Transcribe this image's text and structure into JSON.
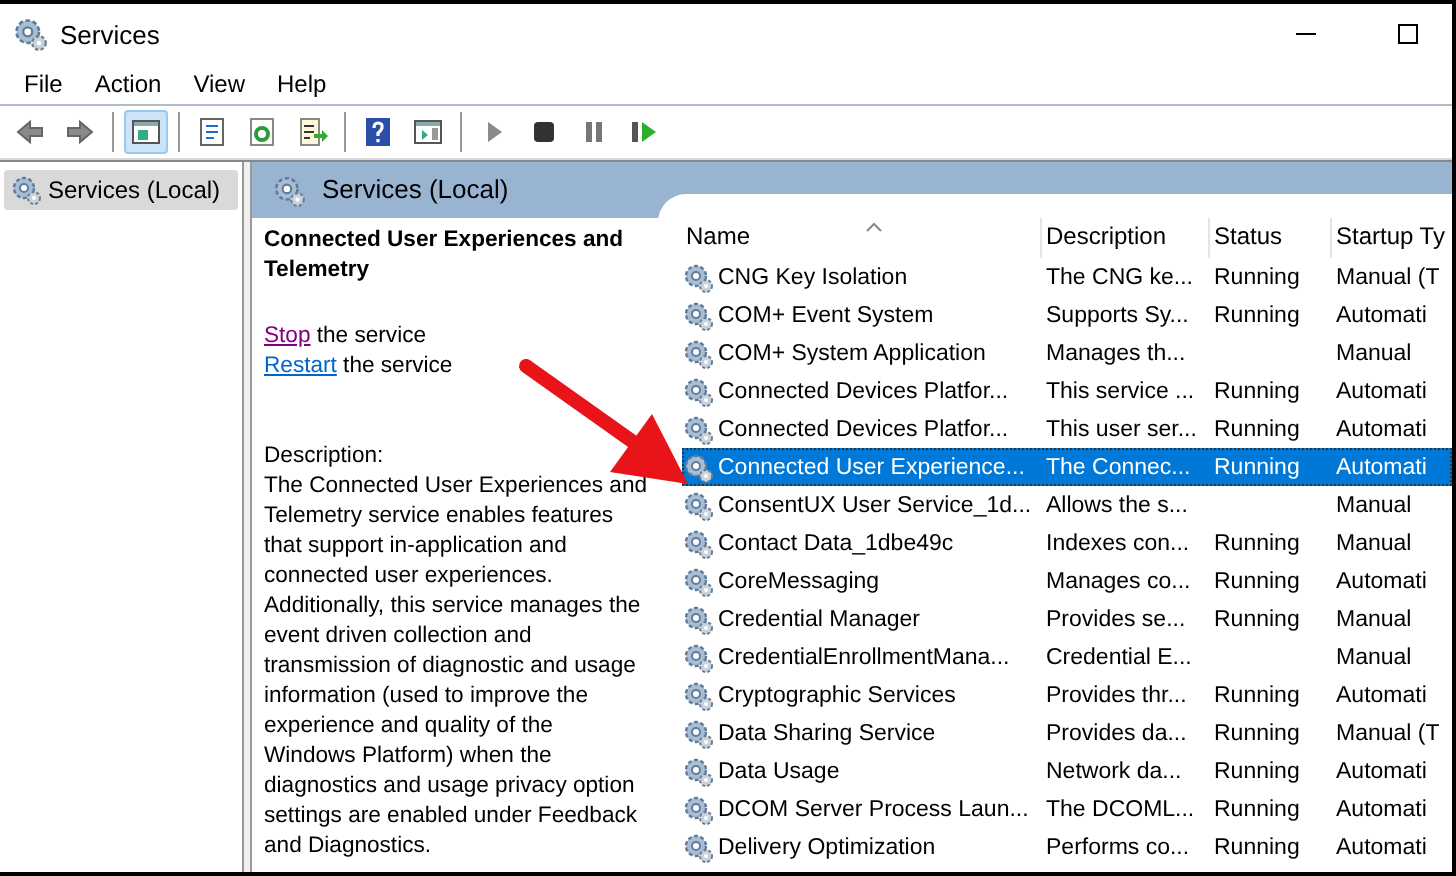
{
  "window": {
    "title": "Services"
  },
  "menu": [
    "File",
    "Action",
    "View",
    "Help"
  ],
  "toolbar": [
    {
      "kind": "back",
      "selected": false
    },
    {
      "kind": "forward",
      "selected": false
    },
    {
      "kind": "sep"
    },
    {
      "kind": "tree",
      "selected": true
    },
    {
      "kind": "sep"
    },
    {
      "kind": "properties",
      "selected": false
    },
    {
      "kind": "refresh",
      "selected": false
    },
    {
      "kind": "export",
      "selected": false
    },
    {
      "kind": "sep"
    },
    {
      "kind": "help",
      "selected": false
    },
    {
      "kind": "pane",
      "selected": false
    },
    {
      "kind": "sep"
    },
    {
      "kind": "play",
      "selected": false
    },
    {
      "kind": "stop",
      "selected": false
    },
    {
      "kind": "pause",
      "selected": false
    },
    {
      "kind": "restart",
      "selected": false
    }
  ],
  "tree": {
    "items": [
      {
        "label": "Services (Local)",
        "selected": true
      }
    ]
  },
  "panel": {
    "title": "Services (Local)"
  },
  "details": {
    "title": "Connected User Experiences and Telemetry",
    "actions": [
      {
        "link": "Stop",
        "text": "the service",
        "visited": true
      },
      {
        "link": "Restart",
        "text": "the service",
        "visited": false
      }
    ],
    "description_label": "Description:",
    "description": "The Connected User Experiences and Telemetry service enables features that support in-application and connected user experiences. Additionally, this service manages the event driven collection and transmission of diagnostic and usage information (used to improve the experience and quality of the Windows Platform) when the diagnostics and usage privacy option settings are enabled under Feedback and Diagnostics."
  },
  "table": {
    "columns": [
      "Name",
      "Description",
      "Status",
      "Startup Ty"
    ],
    "rows": [
      {
        "cells": [
          "CNG Key Isolation",
          "The CNG ke...",
          "Running",
          "Manual (T"
        ],
        "selected": false
      },
      {
        "cells": [
          "COM+ Event System",
          "Supports Sy...",
          "Running",
          "Automati"
        ],
        "selected": false
      },
      {
        "cells": [
          "COM+ System Application",
          "Manages th...",
          "",
          "Manual"
        ],
        "selected": false
      },
      {
        "cells": [
          "Connected Devices Platfor...",
          "This service ...",
          "Running",
          "Automati"
        ],
        "selected": false
      },
      {
        "cells": [
          "Connected Devices Platfor...",
          "This user ser...",
          "Running",
          "Automati"
        ],
        "selected": false
      },
      {
        "cells": [
          "Connected User Experience...",
          "The Connec...",
          "Running",
          "Automati"
        ],
        "selected": true
      },
      {
        "cells": [
          "ConsentUX User Service_1d...",
          "Allows the s...",
          "",
          "Manual"
        ],
        "selected": false
      },
      {
        "cells": [
          "Contact Data_1dbe49c",
          "Indexes con...",
          "Running",
          "Manual"
        ],
        "selected": false
      },
      {
        "cells": [
          "CoreMessaging",
          "Manages co...",
          "Running",
          "Automati"
        ],
        "selected": false
      },
      {
        "cells": [
          "Credential Manager",
          "Provides se...",
          "Running",
          "Manual"
        ],
        "selected": false
      },
      {
        "cells": [
          "CredentialEnrollmentMana...",
          "Credential E...",
          "",
          "Manual"
        ],
        "selected": false
      },
      {
        "cells": [
          "Cryptographic Services",
          "Provides thr...",
          "Running",
          "Automati"
        ],
        "selected": false
      },
      {
        "cells": [
          "Data Sharing Service",
          "Provides da...",
          "Running",
          "Manual (T"
        ],
        "selected": false
      },
      {
        "cells": [
          "Data Usage",
          "Network da...",
          "Running",
          "Automati"
        ],
        "selected": false
      },
      {
        "cells": [
          "DCOM Server Process Laun...",
          "The DCOML...",
          "Running",
          "Automati"
        ],
        "selected": false
      },
      {
        "cells": [
          "Delivery Optimization",
          "Performs co...",
          "Running",
          "Automati"
        ],
        "selected": false
      }
    ]
  }
}
